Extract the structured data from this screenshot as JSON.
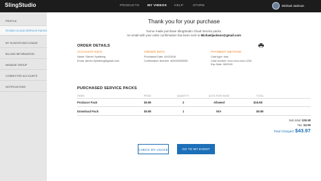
{
  "header": {
    "logo": {
      "part1": "Sling",
      "part2": "Studio"
    },
    "nav": [
      "PRODUCTS",
      "MY VIDEOS",
      "HELP",
      "STORE"
    ],
    "active_nav": "MY VIDEOS",
    "user_name": "Michael Jackson"
  },
  "sidebar": {
    "items": [
      {
        "label": "PROFILE"
      },
      {
        "label": "STUDIO CLOUD SERVICE PACKS",
        "active": true
      },
      {
        "label": "MY SLINGSTUDIO USAGE"
      },
      {
        "label": "BILLING INFORMATION"
      },
      {
        "label": "MANAGE GROUP"
      },
      {
        "label": "CONNECTED ACCOUNTS"
      },
      {
        "label": "NOTIFICATIONS"
      }
    ]
  },
  "main": {
    "title": "Thank you for your purchase",
    "subtitle_line1": "You've made purchase SlingStudio Cloud Service packs.",
    "subtitle_line2_prefix": "An email with your order confirmation has been sent to",
    "email": "Michaeljackson@gmail.com",
    "order_details_heading": "ORDER DETAILS",
    "print_icon": "printer-icon",
    "account_info": {
      "heading": "ACCOUNT INFO",
      "name": "Name: Steven Spielberg",
      "email": "Email: steven.Spielberg@gmail.com"
    },
    "order_info": {
      "heading": "ORDER INFO",
      "date": "Purchased Date: 6/10/2016",
      "confirmation": "Confirmation Number: a00000025005"
    },
    "payment_method": {
      "heading": "PAYMENT METHOD",
      "card_type": "Card type: visa",
      "card_number": "Card number: xxxx-xxxx-xxxx-1234",
      "exp_date": "Exp Date: 06/2018"
    },
    "packs_heading": "PURCHASED SERVICE PACKS",
    "columns": [
      "ITEMS",
      "PRICE",
      "QUANTITY",
      "AUTO-PURCHASE",
      "TOTAL"
    ],
    "rows": [
      {
        "item": "Producer Pack",
        "price": "$9.99",
        "quantity": "2",
        "auto": "Allowed",
        "total": "$19.98"
      },
      {
        "item": "Download Pack",
        "price": "$9.99",
        "quantity": "1",
        "auto": "N/A",
        "total": "$9.99"
      }
    ],
    "subtotal_label": "Sub total:",
    "subtotal_value": "$39.98",
    "tax_label": "Tax:",
    "tax_value": "$3.99",
    "total_label": "Total Charged:",
    "total_value": "$43.97",
    "btn_check_usage": "CHECK MY USAGE",
    "btn_go_event": "GO TO MY EVENT"
  },
  "colors": {
    "accent_blue": "#1d6fb8",
    "orange": "#ee8a2f",
    "topbar": "#1c1c1c",
    "sidebar": "#e6e6e6"
  }
}
